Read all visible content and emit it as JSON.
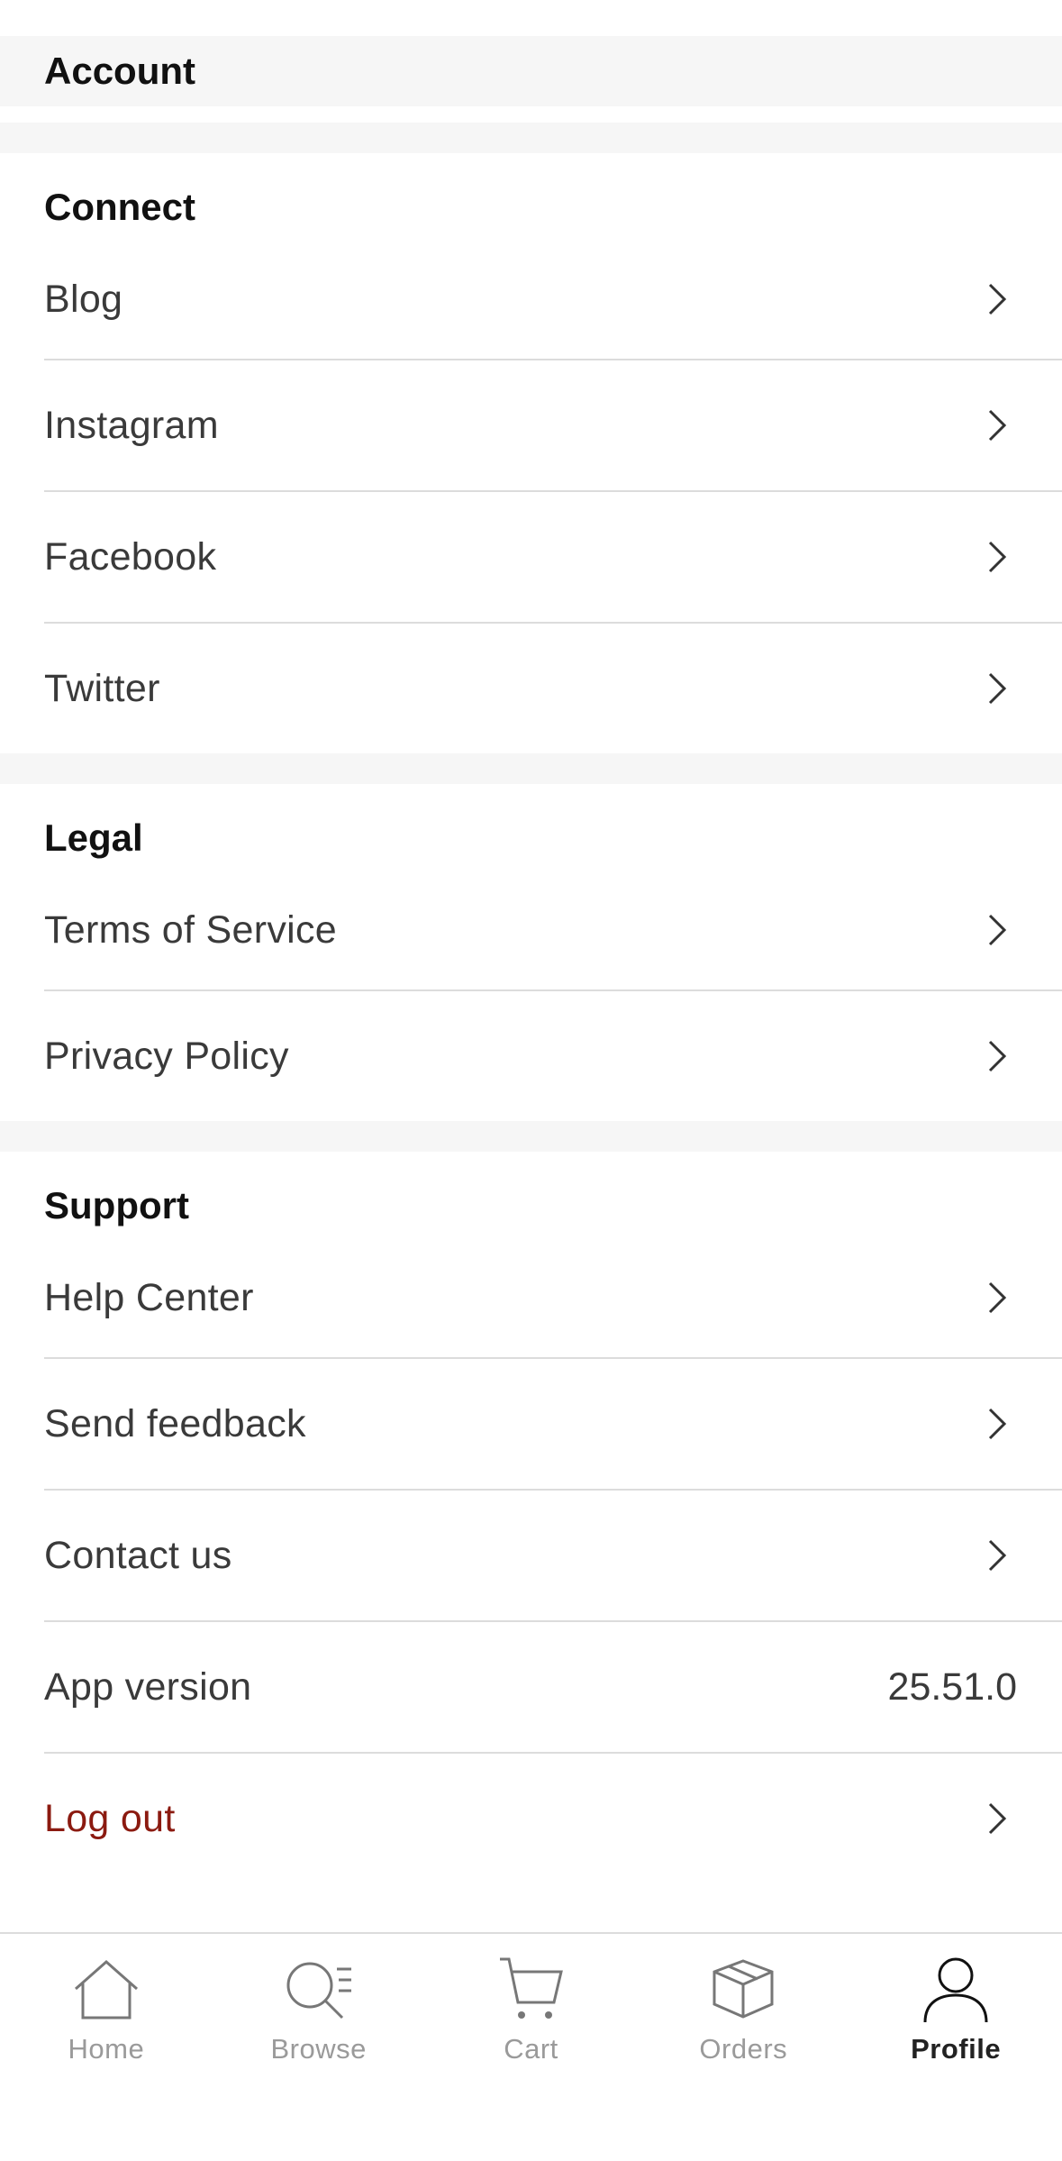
{
  "account": {
    "title": "Account"
  },
  "connect": {
    "title": "Connect",
    "items": [
      {
        "label": "Blog"
      },
      {
        "label": "Instagram"
      },
      {
        "label": "Facebook"
      },
      {
        "label": "Twitter"
      }
    ]
  },
  "legal": {
    "title": "Legal",
    "items": [
      {
        "label": "Terms of Service"
      },
      {
        "label": "Privacy Policy"
      }
    ]
  },
  "support": {
    "title": "Support",
    "items": [
      {
        "label": "Help Center"
      },
      {
        "label": "Send feedback"
      },
      {
        "label": "Contact us"
      }
    ],
    "app_version": {
      "label": "App version",
      "value": "25.51.0"
    },
    "logout": {
      "label": "Log out"
    }
  },
  "tabbar": {
    "tabs": [
      {
        "label": "Home",
        "icon": "home-icon"
      },
      {
        "label": "Browse",
        "icon": "browse-search-icon"
      },
      {
        "label": "Cart",
        "icon": "cart-icon"
      },
      {
        "label": "Orders",
        "icon": "box-icon"
      },
      {
        "label": "Profile",
        "icon": "person-icon"
      }
    ],
    "active": "Profile"
  },
  "colors": {
    "danger": "#8b1a10",
    "section_bg": "#f6f6f6",
    "divider": "#dcdcdc",
    "inactive_tab": "#9a9a9a"
  }
}
